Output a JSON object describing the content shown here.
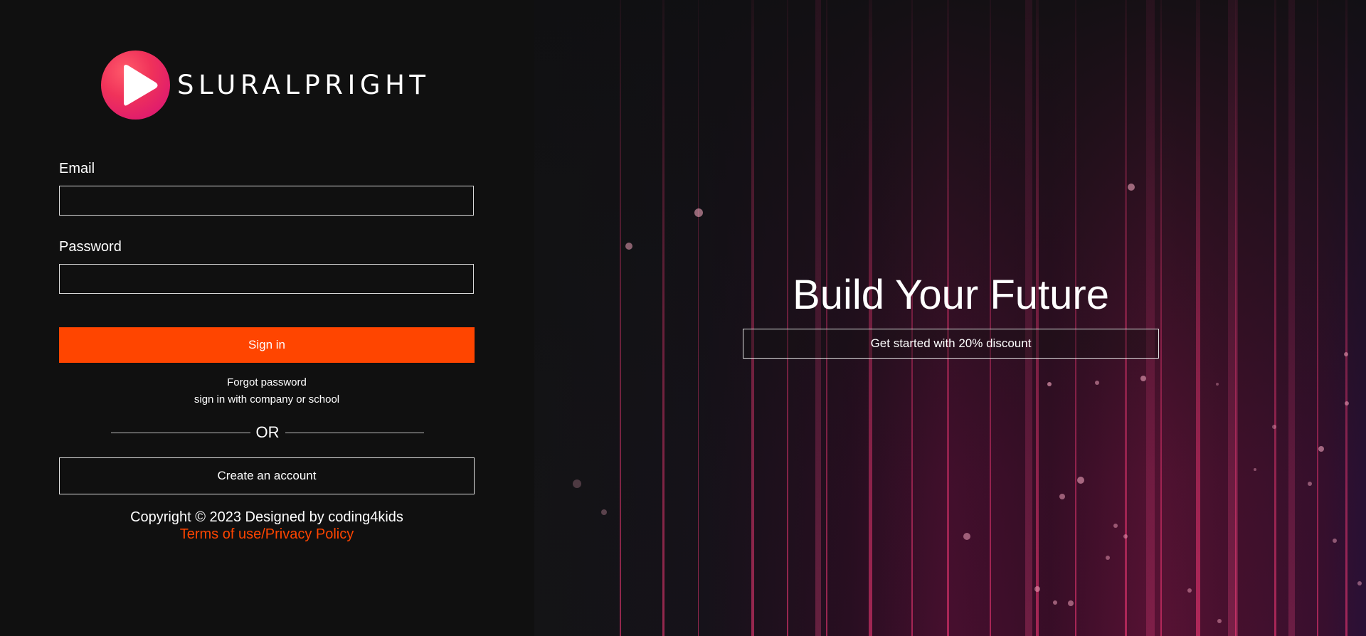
{
  "brand": {
    "name": "SLURALPRIGHT",
    "logo_icon": "play-icon",
    "logo_colors": [
      "#ff5a6a",
      "#d60f78"
    ]
  },
  "login_form": {
    "email_label": "Email",
    "email_value": "",
    "password_label": "Password",
    "password_value": "",
    "signin_label": "Sign in",
    "forgot_password": "Forgot password",
    "company_signin": "sign in with company or school",
    "or_text": "OR",
    "create_account": "Create an account"
  },
  "footer": {
    "copyright": "Copyright © 2023 Designed by coding4kids",
    "terms": "Terms of use/Privacy Policy"
  },
  "hero": {
    "headline": "Build Your Future",
    "cta": "Get started with 20% discount"
  },
  "colors": {
    "accent": "#ff4500",
    "background": "#101010",
    "text": "#ffffff"
  }
}
